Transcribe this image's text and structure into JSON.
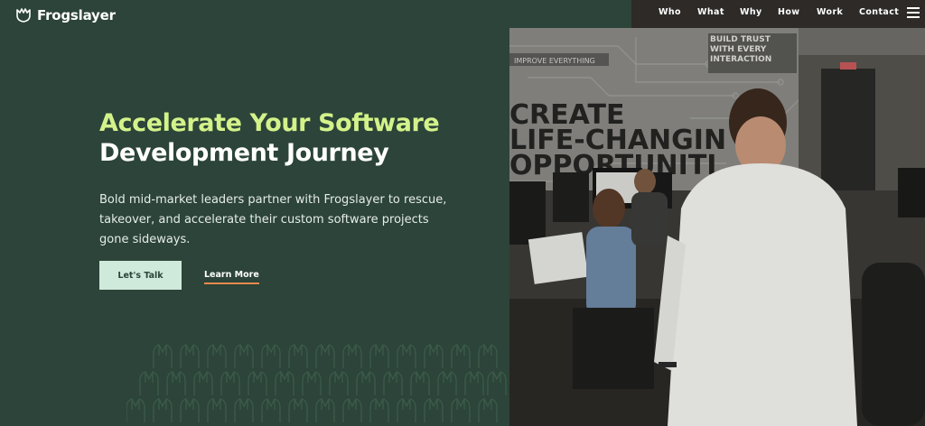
{
  "brand": {
    "name": "Frogslayer"
  },
  "nav": {
    "items": [
      {
        "label": "Who"
      },
      {
        "label": "What"
      },
      {
        "label": "Why"
      },
      {
        "label": "How"
      },
      {
        "label": "Work"
      },
      {
        "label": "Contact"
      }
    ],
    "menu_icon": "hamburger-icon"
  },
  "hero": {
    "title_accent": "Accelerate Your Software",
    "title_main": "Development Journey",
    "description": "Bold mid-market leaders partner with Frogslayer to rescue, takeover, and accelerate their custom software projects gone sideways.",
    "primary_button": "Let's Talk",
    "secondary_link": "Learn More"
  },
  "photo": {
    "wall_text_1": "CREATE",
    "wall_text_2": "LIFE-CHANGIN",
    "wall_text_3": "OPPORTUNITI",
    "sign_text": "BUILD TRUST WITH EVERY INTERACTION",
    "strip_text": "IMPROVE EVERYTHING"
  },
  "colors": {
    "background": "#2c4439",
    "accent_green": "#d3f28a",
    "button_bg": "#cfe9db",
    "link_underline": "#e58a4c",
    "nav_bg": "#2d2a28"
  }
}
